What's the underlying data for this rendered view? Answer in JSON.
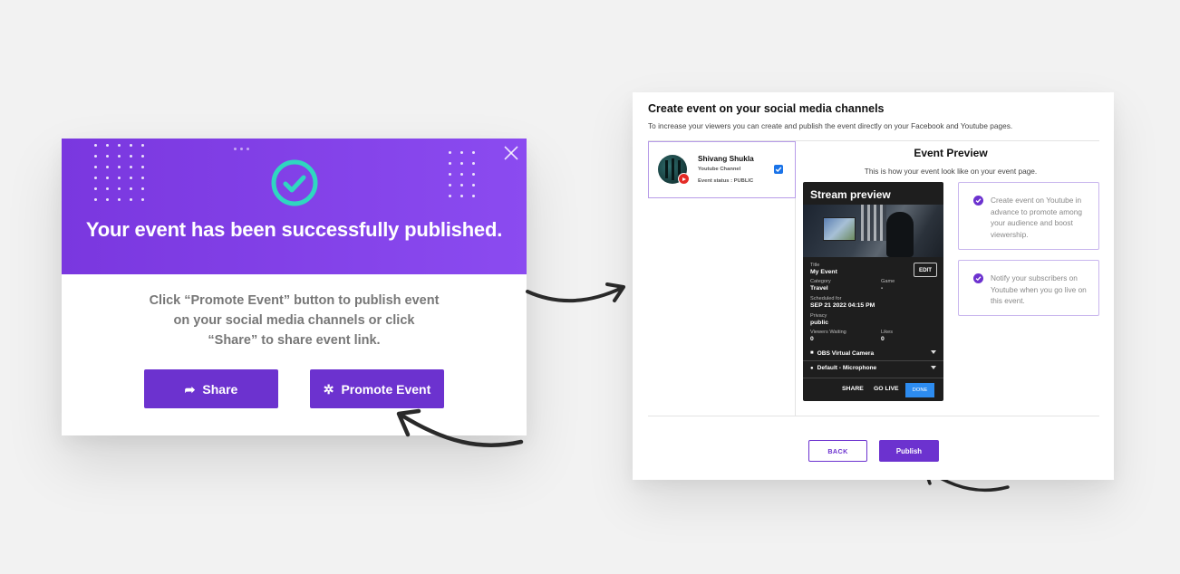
{
  "success_dialog": {
    "title": "Your event has been successfully published.",
    "body_lines": [
      "Click “Promote Event” button to publish event",
      "on your social media channels or click",
      "“Share” to share event link."
    ],
    "share_label": "Share",
    "promote_label": "Promote Event",
    "accent_color": "#6c32cf",
    "header_color": "#8b4bf0",
    "check_color": "#2fd7c0"
  },
  "panel": {
    "title": "Create event on your social media channels",
    "subtitle": "To increase your viewers you can create and publish the event directly on your Facebook and Youtube pages.",
    "channel": {
      "name": "Shivang Shukla",
      "type": "Youtube Channel",
      "status": "Event status :  PUBLIC",
      "selected": true
    },
    "preview": {
      "title": "Event Preview",
      "subtitle": "This is how your event look like on your event page."
    },
    "stream": {
      "header": "Stream preview",
      "edit_label": "EDIT",
      "fields": {
        "title_label": "Title",
        "title_value": "My Event",
        "category_label": "Category",
        "category_value": "Travel",
        "game_label": "Game",
        "game_value": "-",
        "scheduled_label": "Scheduled for",
        "scheduled_value": "SEP 21 2022 04:15 PM",
        "privacy_label": "Privacy",
        "privacy_value": "public",
        "viewers_label": "Viewers Waiting",
        "viewers_value": "0",
        "likes_label": "Likes",
        "likes_value": "0"
      },
      "camera": "OBS Virtual Camera",
      "microphone": "Default - Microphone",
      "share_label": "SHARE",
      "golive_label": "GO LIVE",
      "done_label": "DONE"
    },
    "info_cards": [
      "Create event on Youtube in advance to promote among your audience and boost viewership.",
      "Notify your subscribers on Youtube when you go live on this event."
    ],
    "back_label": "BACK",
    "publish_label": "Publish"
  }
}
